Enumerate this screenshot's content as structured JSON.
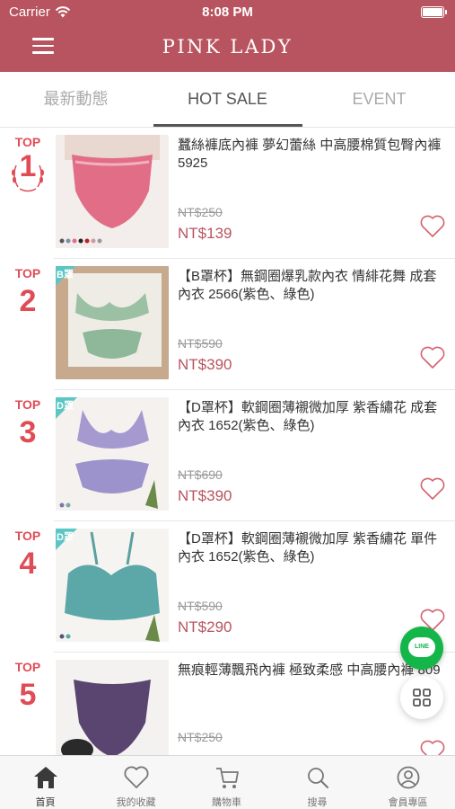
{
  "status_bar": {
    "carrier": "Carrier",
    "time": "8:08 PM"
  },
  "header": {
    "brand": "PINK LADY",
    "menu_icon": "hamburger-icon"
  },
  "tabs": [
    {
      "label": "最新動態",
      "active": false
    },
    {
      "label": "HOT SALE",
      "active": true
    },
    {
      "label": "EVENT",
      "active": false
    }
  ],
  "products": [
    {
      "rank_label": "TOP",
      "rank": "1",
      "title": "蠶絲褲底內褲 夢幻蕾絲 中高腰棉質包臀內褲 5925",
      "old_price": "NT$250",
      "price": "NT$139",
      "badge": ""
    },
    {
      "rank_label": "TOP",
      "rank": "2",
      "title": "【B罩杯】無鋼圈爆乳款內衣 情緋花舞 成套內衣 2566(紫色、綠色)",
      "old_price": "NT$590",
      "price": "NT$390",
      "badge": "B罩"
    },
    {
      "rank_label": "TOP",
      "rank": "3",
      "title": "【D罩杯】軟鋼圈薄襯微加厚 紫香繡花 成套內衣 1652(紫色、綠色)",
      "old_price": "NT$690",
      "price": "NT$390",
      "badge": "D罩"
    },
    {
      "rank_label": "TOP",
      "rank": "4",
      "title": "【D罩杯】軟鋼圈薄襯微加厚 紫香繡花 單件內衣 1652(紫色、綠色)",
      "old_price": "NT$590",
      "price": "NT$290",
      "badge": "D罩"
    },
    {
      "rank_label": "TOP",
      "rank": "5",
      "title": "無痕輕薄飄飛內褲 極致柔感 中高腰內褲 809",
      "old_price": "NT$250",
      "price": "",
      "badge": ""
    }
  ],
  "floating": {
    "line_label": "LINE"
  },
  "tabbar": [
    {
      "label": "首頁",
      "icon": "home-icon",
      "active": true
    },
    {
      "label": "我的收藏",
      "icon": "heart-icon",
      "active": false
    },
    {
      "label": "購物車",
      "icon": "cart-icon",
      "active": false
    },
    {
      "label": "搜尋",
      "icon": "search-icon",
      "active": false
    },
    {
      "label": "會員專區",
      "icon": "user-icon",
      "active": false
    }
  ],
  "colors": {
    "brand": "#b8545f",
    "rank": "#e04c56",
    "line_green": "#14b64a"
  }
}
